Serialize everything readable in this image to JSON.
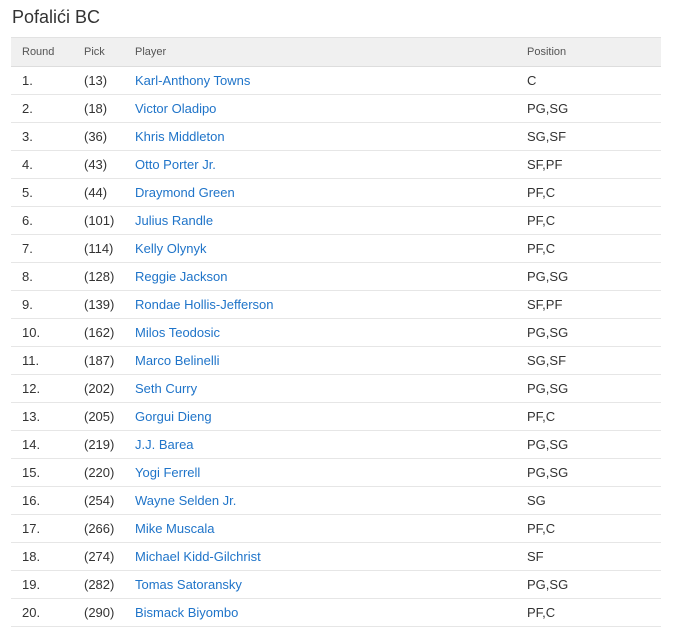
{
  "team": {
    "title": "Pofalići BC"
  },
  "table": {
    "headers": {
      "round": "Round",
      "pick": "Pick",
      "player": "Player",
      "position": "Position"
    },
    "rows": [
      {
        "round": "1.",
        "pick": "(13)",
        "player": "Karl-Anthony Towns",
        "position": "C"
      },
      {
        "round": "2.",
        "pick": "(18)",
        "player": "Victor Oladipo",
        "position": "PG,SG"
      },
      {
        "round": "3.",
        "pick": "(36)",
        "player": "Khris Middleton",
        "position": "SG,SF"
      },
      {
        "round": "4.",
        "pick": "(43)",
        "player": "Otto Porter Jr.",
        "position": "SF,PF"
      },
      {
        "round": "5.",
        "pick": "(44)",
        "player": "Draymond Green",
        "position": "PF,C"
      },
      {
        "round": "6.",
        "pick": "(101)",
        "player": "Julius Randle",
        "position": "PF,C"
      },
      {
        "round": "7.",
        "pick": "(114)",
        "player": "Kelly Olynyk",
        "position": "PF,C"
      },
      {
        "round": "8.",
        "pick": "(128)",
        "player": "Reggie Jackson",
        "position": "PG,SG"
      },
      {
        "round": "9.",
        "pick": "(139)",
        "player": "Rondae Hollis-Jefferson",
        "position": "SF,PF"
      },
      {
        "round": "10.",
        "pick": "(162)",
        "player": "Milos Teodosic",
        "position": "PG,SG"
      },
      {
        "round": "11.",
        "pick": "(187)",
        "player": "Marco Belinelli",
        "position": "SG,SF"
      },
      {
        "round": "12.",
        "pick": "(202)",
        "player": "Seth Curry",
        "position": "PG,SG"
      },
      {
        "round": "13.",
        "pick": "(205)",
        "player": "Gorgui Dieng",
        "position": "PF,C"
      },
      {
        "round": "14.",
        "pick": "(219)",
        "player": "J.J. Barea",
        "position": "PG,SG"
      },
      {
        "round": "15.",
        "pick": "(220)",
        "player": "Yogi Ferrell",
        "position": "PG,SG"
      },
      {
        "round": "16.",
        "pick": "(254)",
        "player": "Wayne Selden Jr.",
        "position": "SG"
      },
      {
        "round": "17.",
        "pick": "(266)",
        "player": "Mike Muscala",
        "position": "PF,C"
      },
      {
        "round": "18.",
        "pick": "(274)",
        "player": "Michael Kidd-Gilchrist",
        "position": "SF"
      },
      {
        "round": "19.",
        "pick": "(282)",
        "player": "Tomas Satoransky",
        "position": "PG,SG"
      },
      {
        "round": "20.",
        "pick": "(290)",
        "player": "Bismack Biyombo",
        "position": "PF,C"
      }
    ]
  },
  "colors": {
    "link": "#1f74c9",
    "header_bg": "#f0f0f0",
    "text": "#333333"
  }
}
